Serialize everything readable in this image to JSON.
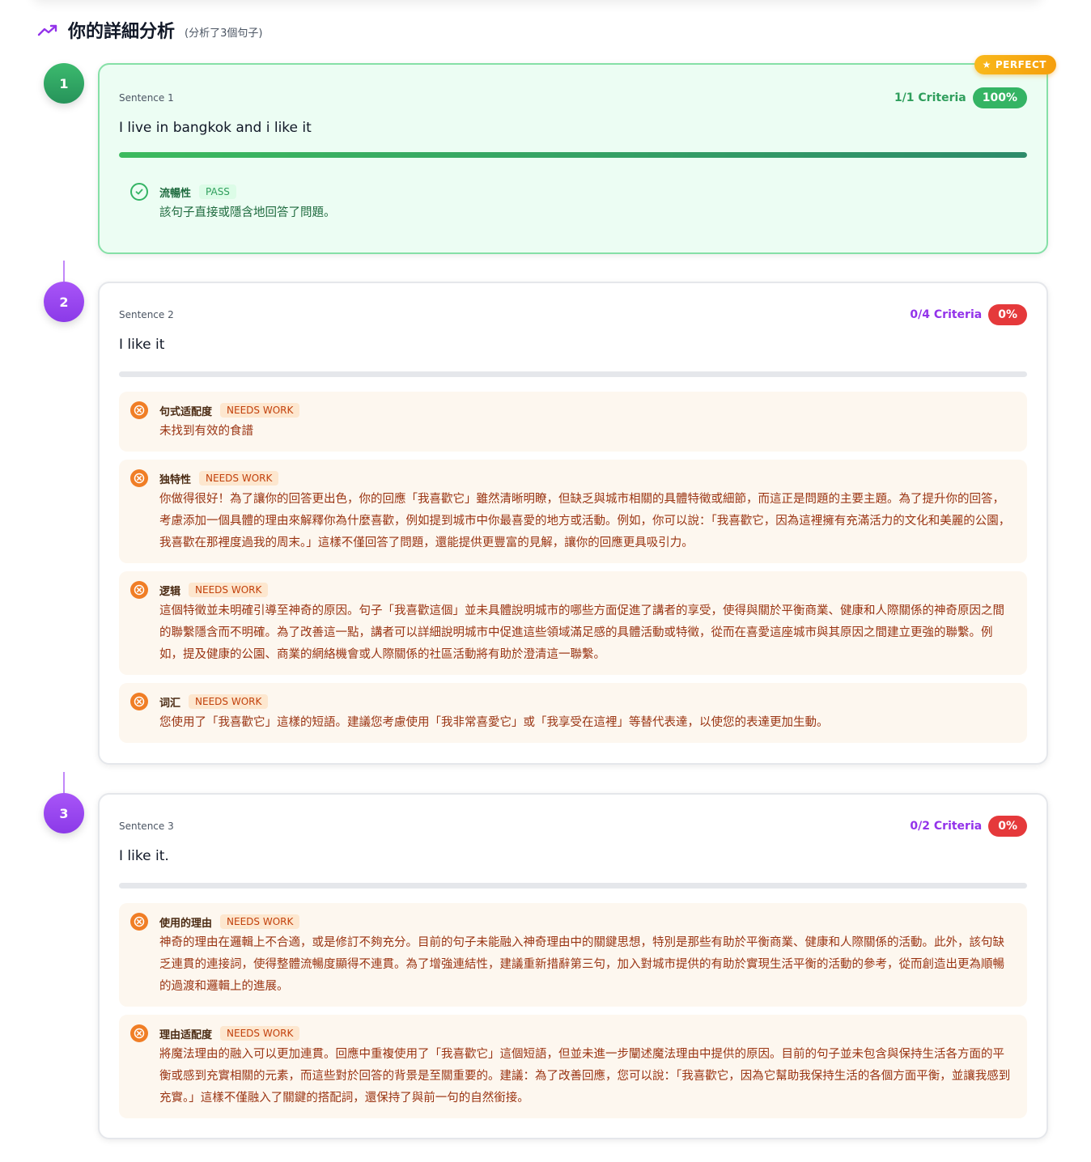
{
  "header": {
    "title": "你的詳細分析",
    "subtitle": "(分析了3個句子)",
    "icon": "trending-up-icon",
    "accent_color": "#9333ea"
  },
  "sentences": [
    {
      "number": "1",
      "label": "Sentence 1",
      "text": "I live in bangkok and i like it",
      "criteria": "1/1 Criteria",
      "percent": "100%",
      "progress": 1.0,
      "badge": "PERFECT",
      "items": [
        {
          "name": "流暢性",
          "status": "PASS",
          "body": "該句子直接或隱含地回答了問題。"
        }
      ]
    },
    {
      "number": "2",
      "label": "Sentence 2",
      "text": "I like it",
      "criteria": "0/4 Criteria",
      "percent": "0%",
      "progress": 0.0,
      "items": [
        {
          "name": "句式适配度",
          "status": "NEEDS WORK",
          "body": "未找到有效的食譜"
        },
        {
          "name": "独特性",
          "status": "NEEDS WORK",
          "body": "你做得很好！為了讓你的回答更出色，你的回應「我喜歡它」雖然清晰明瞭，但缺乏與城市相關的具體特徵或細節，而這正是問題的主要主題。為了提升你的回答，考慮添加一個具體的理由來解釋你為什麼喜歡，例如提到城市中你最喜愛的地方或活動。例如，你可以說：「我喜歡它，因為這裡擁有充滿活力的文化和美麗的公園，我喜歡在那裡度過我的周末。」這樣不僅回答了問題，還能提供更豐富的見解，讓你的回應更具吸引力。"
        },
        {
          "name": "逻辑",
          "status": "NEEDS WORK",
          "body": "這個特徵並未明確引導至神奇的原因。句子「我喜歡這個」並未具體說明城市的哪些方面促進了講者的享受，使得與關於平衡商業、健康和人際關係的神奇原因之間的聯繫隱含而不明確。為了改善這一點，講者可以詳細說明城市中促進這些領域滿足感的具體活動或特徵，從而在喜愛這座城市與其原因之間建立更強的聯繫。例如，提及健康的公園、商業的網絡機會或人際關係的社區活動將有助於澄清這一聯繫。"
        },
        {
          "name": "词汇",
          "status": "NEEDS WORK",
          "body": "您使用了「我喜歡它」這樣的短語。建議您考慮使用「我非常喜愛它」或「我享受在這裡」等替代表達，以使您的表達更加生動。"
        }
      ]
    },
    {
      "number": "3",
      "label": "Sentence 3",
      "text": "I like it.",
      "criteria": "0/2 Criteria",
      "percent": "0%",
      "progress": 0.0,
      "items": [
        {
          "name": "使用的理由",
          "status": "NEEDS WORK",
          "body": "神奇的理由在邏輯上不合適，或是修訂不夠充分。目前的句子未能融入神奇理由中的關鍵思想，特別是那些有助於平衡商業、健康和人際關係的活動。此外，該句缺乏連貫的連接詞，使得整體流暢度顯得不連貫。為了增強連結性，建議重新措辭第三句，加入對城市提供的有助於實現生活平衡的活動的參考，從而創造出更為順暢的過渡和邏輯上的進展。"
        },
        {
          "name": "理由适配度",
          "status": "NEEDS WORK",
          "body": "將魔法理由的融入可以更加連貫。回應中重複使用了「我喜歡它」這個短語，但並未進一步闡述魔法理由中提供的原因。目前的句子並未包含與保持生活各方面的平衡或感到充實相關的元素，而這些對於回答的背景是至關重要的。建議：為了改善回應，您可以說：「我喜歡它，因為它幫助我保持生活的各個方面平衡，並讓我感到充實。」這樣不僅融入了關鍵的搭配詞，還保持了與前一句的自然銜接。"
        }
      ]
    }
  ]
}
